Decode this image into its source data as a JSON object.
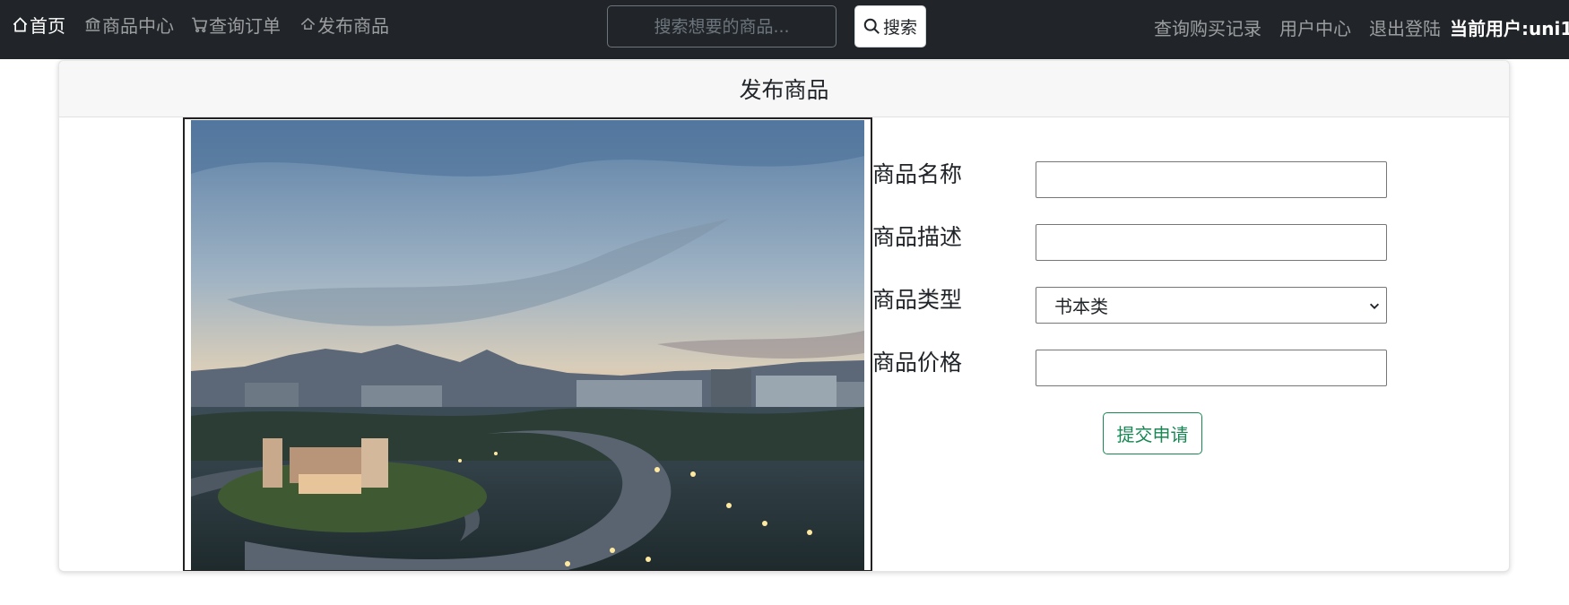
{
  "nav": {
    "home": "首页",
    "products": "商品中心",
    "orders": "查询订单",
    "publish": "发布商品",
    "purchase_history": "查询购买记录",
    "user_center": "用户中心",
    "logout": "退出登陆",
    "current_user": "当前用户:uni1"
  },
  "search": {
    "placeholder": "搜索想要的商品...",
    "button_label": "搜索"
  },
  "card": {
    "title": "发布商品"
  },
  "form": {
    "name_label": "商品名称",
    "name_value": "",
    "desc_label": "商品描述",
    "desc_value": "",
    "type_label": "商品类型",
    "type_selected": "书本类",
    "price_label": "商品价格",
    "price_value": "",
    "submit_label": "提交申请"
  },
  "colors": {
    "navbar_bg": "#212529",
    "success": "#198754"
  }
}
